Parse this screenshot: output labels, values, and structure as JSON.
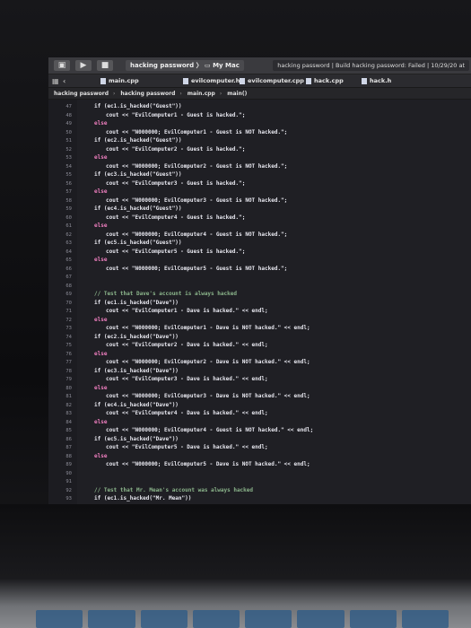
{
  "toolbar": {
    "scheme": "hacking password",
    "device": "My Mac",
    "status": "hacking password | Build hacking password: Failed | 10/29/20 at"
  },
  "tabs": [
    "main.cpp",
    "evilcomputer.h",
    "evilcomputer.cpp",
    "hack.cpp",
    "hack.h"
  ],
  "breadcrumbs": [
    "hacking password",
    "hacking password",
    "main.cpp",
    "main()"
  ],
  "code": [
    {
      "n": "47",
      "t": "if (ec1.is_hacked(\"Guest\"))",
      "i": 1
    },
    {
      "n": "48",
      "t": "cout << \"EvilComputer1 - Guest is hacked.\";",
      "i": 2
    },
    {
      "n": "49",
      "t": "else",
      "i": 1
    },
    {
      "n": "50",
      "t": "cout << \"N000000; EvilComputer1 - Guest is NOT hacked.\";",
      "i": 2
    },
    {
      "n": "51",
      "t": "if (ec2.is_hacked(\"Guest\"))",
      "i": 1
    },
    {
      "n": "52",
      "t": "cout << \"EvilComputer2 - Guest is hacked.\";",
      "i": 2
    },
    {
      "n": "53",
      "t": "else",
      "i": 1
    },
    {
      "n": "54",
      "t": "cout << \"N000000; EvilComputer2 - Guest is NOT hacked.\";",
      "i": 2
    },
    {
      "n": "55",
      "t": "if (ec3.is_hacked(\"Guest\"))",
      "i": 1
    },
    {
      "n": "56",
      "t": "cout << \"EvilComputer3 - Guest is hacked.\";",
      "i": 2
    },
    {
      "n": "57",
      "t": "else",
      "i": 1
    },
    {
      "n": "58",
      "t": "cout << \"N000000; EvilComputer3 - Guest is NOT hacked.\";",
      "i": 2
    },
    {
      "n": "59",
      "t": "if (ec4.is_hacked(\"Guest\"))",
      "i": 1
    },
    {
      "n": "60",
      "t": "cout << \"EvilComputer4 - Guest is hacked.\";",
      "i": 2
    },
    {
      "n": "61",
      "t": "else",
      "i": 1
    },
    {
      "n": "62",
      "t": "cout << \"N000000; EvilComputer4 - Guest is NOT hacked.\";",
      "i": 2
    },
    {
      "n": "63",
      "t": "if (ec5.is_hacked(\"Guest\"))",
      "i": 1
    },
    {
      "n": "64",
      "t": "cout << \"EvilComputer5 - Guest is hacked.\";",
      "i": 2
    },
    {
      "n": "65",
      "t": "else",
      "i": 1
    },
    {
      "n": "66",
      "t": "cout << \"N000000; EvilComputer5 - Guest is NOT hacked.\";",
      "i": 2
    },
    {
      "n": "67",
      "t": "",
      "i": 0
    },
    {
      "n": "68",
      "t": "",
      "i": 0
    },
    {
      "n": "69",
      "t": "// Test that Dave's account is always hacked",
      "i": 1
    },
    {
      "n": "70",
      "t": "if (ec1.is_hacked(\"Dave\"))",
      "i": 1
    },
    {
      "n": "71",
      "t": "cout << \"EvilComputer1 - Dave is hacked.\" << endl;",
      "i": 2
    },
    {
      "n": "72",
      "t": "else",
      "i": 1
    },
    {
      "n": "73",
      "t": "cout << \"N000000; EvilComputer1 - Dave is NOT hacked.\" << endl;",
      "i": 2
    },
    {
      "n": "74",
      "t": "if (ec2.is_hacked(\"Dave\"))",
      "i": 1
    },
    {
      "n": "75",
      "t": "cout << \"EvilComputer2 - Dave is hacked.\" << endl;",
      "i": 2
    },
    {
      "n": "76",
      "t": "else",
      "i": 1
    },
    {
      "n": "77",
      "t": "cout << \"N000000; EvilComputer2 - Dave is NOT hacked.\" << endl;",
      "i": 2
    },
    {
      "n": "78",
      "t": "if (ec3.is_hacked(\"Dave\"))",
      "i": 1
    },
    {
      "n": "79",
      "t": "cout << \"EvilComputer3 - Dave is hacked.\" << endl;",
      "i": 2
    },
    {
      "n": "80",
      "t": "else",
      "i": 1
    },
    {
      "n": "81",
      "t": "cout << \"N000000; EvilComputer3 - Dave is NOT hacked.\" << endl;",
      "i": 2
    },
    {
      "n": "82",
      "t": "if (ec4.is_hacked(\"Dave\"))",
      "i": 1
    },
    {
      "n": "83",
      "t": "cout << \"EvilComputer4 - Dave is hacked.\" << endl;",
      "i": 2
    },
    {
      "n": "84",
      "t": "else",
      "i": 1
    },
    {
      "n": "85",
      "t": "cout << \"N000000; EvilComputer4 - Guest is NOT hacked.\" << endl;",
      "i": 2
    },
    {
      "n": "86",
      "t": "if (ec5.is_hacked(\"Dave\"))",
      "i": 1
    },
    {
      "n": "87",
      "t": "cout << \"EvilComputer5 - Dave is hacked.\" << endl;",
      "i": 2
    },
    {
      "n": "88",
      "t": "else",
      "i": 1
    },
    {
      "n": "89",
      "t": "cout << \"N000000; EvilComputer5 - Dave is NOT hacked.\" << endl;",
      "i": 2
    },
    {
      "n": "90",
      "t": "",
      "i": 0
    },
    {
      "n": "91",
      "t": "",
      "i": 0
    },
    {
      "n": "92",
      "t": "// Test that Mr. Mean's account was always hacked",
      "i": 1
    },
    {
      "n": "93",
      "t": "if (ec1.is_hacked(\"Mr. Mean\"))",
      "i": 1
    }
  ]
}
